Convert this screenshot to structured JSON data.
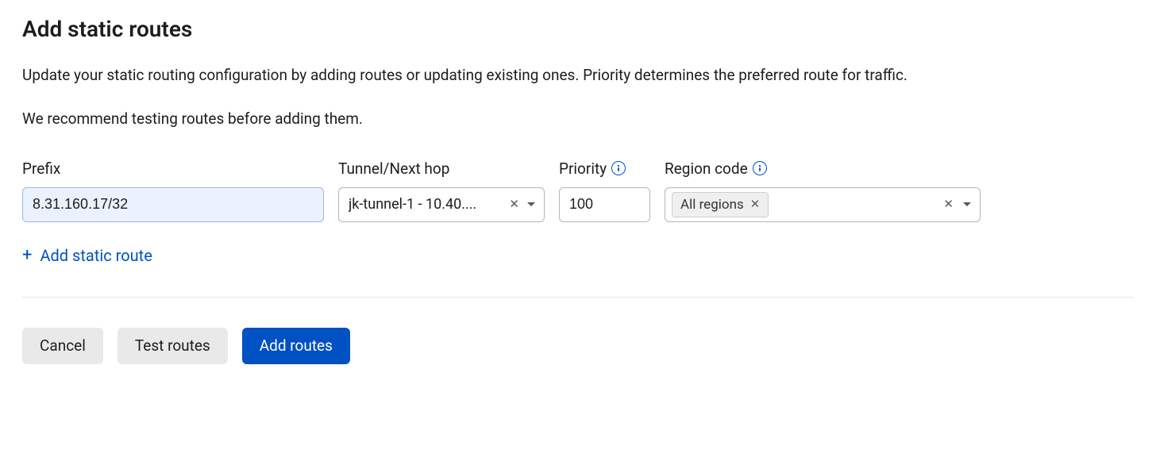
{
  "title": "Add static routes",
  "description": "Update your static routing configuration by adding routes or updating existing ones. Priority determines the preferred route for traffic.",
  "recommend": "We recommend testing routes before adding them.",
  "labels": {
    "prefix": "Prefix",
    "tunnel": "Tunnel/Next hop",
    "priority": "Priority",
    "region": "Region code"
  },
  "route": {
    "prefix": "8.31.160.17/32",
    "tunnel_display": "jk-tunnel-1 - 10.40....",
    "priority": "100",
    "region_chip": "All regions"
  },
  "add_link": "Add static route",
  "buttons": {
    "cancel": "Cancel",
    "test": "Test routes",
    "add": "Add routes"
  }
}
